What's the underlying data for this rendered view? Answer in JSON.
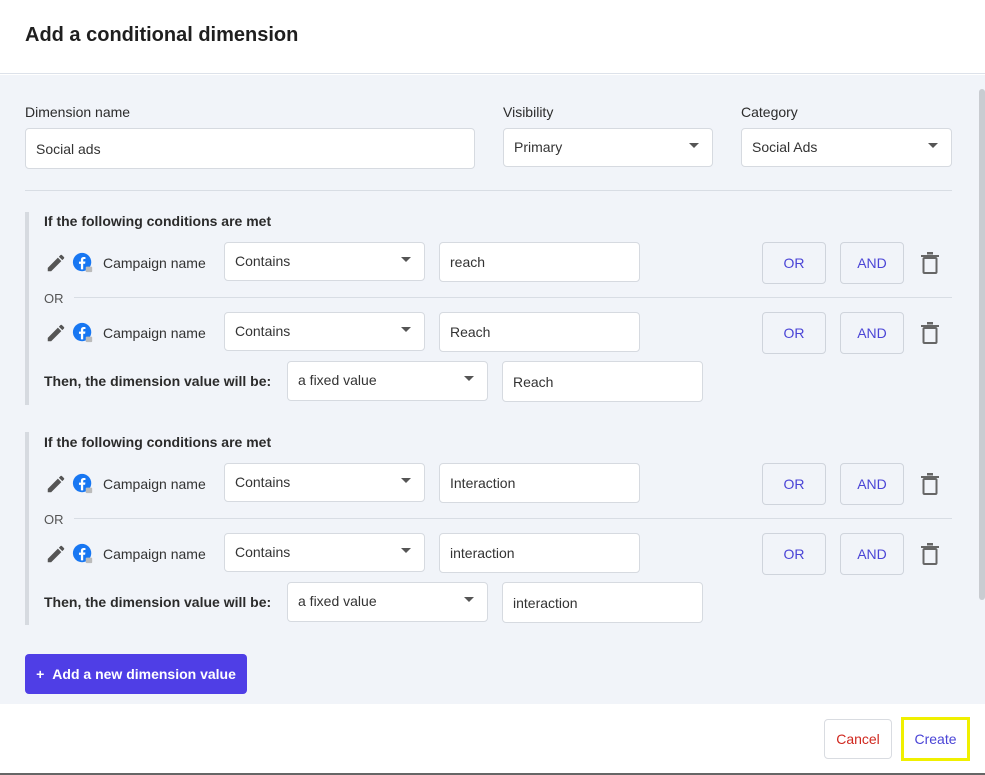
{
  "dialog": {
    "title": "Add a conditional dimension"
  },
  "form": {
    "dimension_name_label": "Dimension name",
    "dimension_name_value": "Social ads",
    "visibility_label": "Visibility",
    "visibility_value": "Primary",
    "category_label": "Category",
    "category_value": "Social Ads"
  },
  "groups": [
    {
      "title": "If the following conditions are met",
      "conditions": [
        {
          "field": "Campaign name",
          "operator": "Contains",
          "value": "reach",
          "or_label": "OR",
          "and_label": "AND"
        },
        {
          "field": "Campaign name",
          "operator": "Contains",
          "value": "Reach",
          "or_label": "OR",
          "and_label": "AND"
        }
      ],
      "separator": "OR",
      "then_label": "Then, the dimension value will be:",
      "then_type": "a fixed value",
      "then_value": "Reach"
    },
    {
      "title": "If the following conditions are met",
      "conditions": [
        {
          "field": "Campaign name",
          "operator": "Contains",
          "value": "Interaction",
          "or_label": "OR",
          "and_label": "AND"
        },
        {
          "field": "Campaign name",
          "operator": "Contains",
          "value": "interaction",
          "or_label": "OR",
          "and_label": "AND"
        }
      ],
      "separator": "OR",
      "then_label": "Then, the dimension value will be:",
      "then_type": "a fixed value",
      "then_value": "interaction"
    }
  ],
  "actions": {
    "add_plus": "+",
    "add_label": "Add a new dimension value",
    "cancel_label": "Cancel",
    "create_label": "Create"
  },
  "icons": {
    "edit": "pencil-icon",
    "source": "facebook-icon",
    "delete": "trash-icon",
    "dropdown": "chevron-down-icon"
  },
  "colors": {
    "accent": "#4f3ee6",
    "link": "#4a44d6",
    "cancel": "#d0281f",
    "facebook": "#1877f2",
    "highlight": "#f0f000"
  }
}
